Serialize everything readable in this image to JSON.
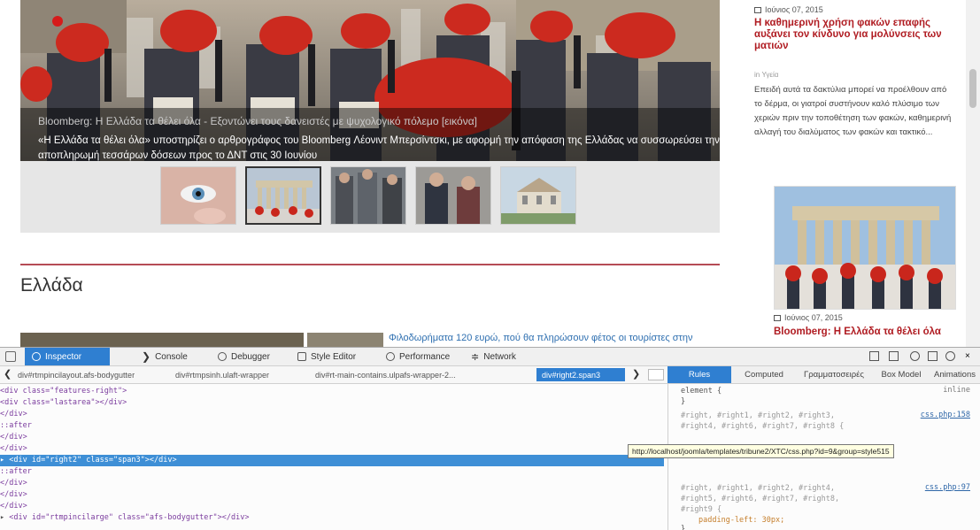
{
  "site": {
    "slider": {
      "title": "Bloomberg: Η Ελλάδα τα θέλει όλα - Εξοντώνει τους δανειστές με ψυχολογικό πόλεμο [εικόνα]",
      "text": "«Η Ελλάδα τα θέλει όλα» υποστηρίζει ο αρθρογράφος του Bloomberg Λέονιντ Μπερσίντσκι, με αφορμή την απόφαση της Ελλάδας να συσσωρεύσει την αποπληρωμή τεσσάρων δόσεων προς το ΔΝΤ στις 30 Ιουνίου"
    },
    "section_heading": "Ελλάδα",
    "article_title": "Φιλοδωρήματα 120 ευρώ, πού θα πληρώσουν φέτος οι τουρίστες στην",
    "sidebar": {
      "date_1": "Ιούνιος 07, 2015",
      "title_1": "Η καθημερινή χρήση φακών επαφής αυξάνει τον κίνδυνο για μολύνσεις των ματιών",
      "tag": "in Υγεία",
      "excerpt": "Επειδή αυτά τα δακτύλια μπορεί να προέλθουν από το δέρμα, οι γιατροί συστήνουν καλό πλύσιμο των χεριών πριν την τοποθέτηση των φακών, καθημερινή αλλαγή του διαλύματος των φακών και τακτικό...",
      "date_2": "Ιούνιος 07, 2015",
      "title_2": "Bloomberg: Η Ελλάδα τα θέλει όλα"
    }
  },
  "devtools": {
    "tabs": [
      {
        "label": "Inspector",
        "icon": "inspector-icon"
      },
      {
        "label": "Console",
        "icon": "console-icon"
      },
      {
        "label": "Debugger",
        "icon": "debugger-icon"
      },
      {
        "label": "Style Editor",
        "icon": "style-editor-icon"
      },
      {
        "label": "Performance",
        "icon": "performance-icon"
      },
      {
        "label": "Network",
        "icon": "network-icon"
      }
    ],
    "breadcrumbs": [
      "div#rtmpincilayout.afs-bodygutter",
      "div#rtmpsinh.ulaft-wrapper",
      "div#rt-main-contains.ulpafs-wrapper-2...",
      "div#right2.span3"
    ],
    "side_tabs": [
      "Rules",
      "Computed",
      "Γραμματοσειρές",
      "Box Model",
      "Animations"
    ],
    "markup": [
      {
        "indent": "          ",
        "tag": "<div class=\"features-right\">"
      },
      {
        "indent": "            ",
        "tag": "<div class=\"lastarea\"></div>"
      },
      {
        "indent": "          ",
        "tag": "</div>"
      },
      {
        "indent": "            ",
        "tag": "::after"
      },
      {
        "indent": "        ",
        "tag": "</div>"
      },
      {
        "indent": "      ",
        "tag": "</div>"
      },
      {
        "indent": "    ▸ ",
        "tag": "<div id=\"right2\" class=\"span3\"></div>"
      },
      {
        "indent": "      ",
        "tag": "::after"
      },
      {
        "indent": "    ",
        "tag": "</div>"
      },
      {
        "indent": "  ",
        "tag": "</div>"
      },
      {
        "indent": "",
        "tag": "</div>"
      },
      {
        "indent": "▸ ",
        "tag": "<div id=\"rtmpincilarge\" class=\"afs-bodygutter\"></div>"
      }
    ],
    "rules": {
      "element_selector": "element {",
      "element_close": "}",
      "inline_label": "inline",
      "rule1_selector": "#right, #right1, #right2, #right3,",
      "rule1_selector_2": "#right4, #right6, #right7, #right8 {",
      "rule1_source": "css.php:158",
      "tooltip": "http://localhost/joomla/templates/tribune2/XTC/css.php?id=9&group=style515",
      "rule2_selector": "#right, #right1, #right2, #right4,",
      "rule2_selector_2": "#right5, #right6, #right7, #right8,",
      "rule2_selector_3": "#right9 {",
      "rule2_prop": "padding-left: 30px;",
      "rule2_close": "}",
      "rule2_source": "css.php:97"
    }
  }
}
